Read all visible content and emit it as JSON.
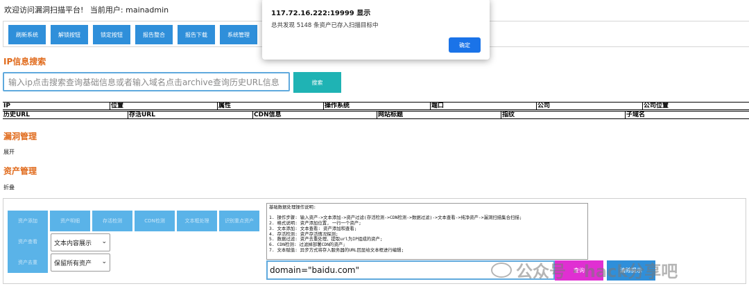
{
  "header": {
    "greeting": "欢迎访问漏洞扫描平台!",
    "current_user_label": "当前用户:",
    "username": "mainadmin"
  },
  "toolbar": {
    "buttons": [
      "刷新系统",
      "解锁按钮",
      "锁定按钮",
      "报告整合",
      "报告下载",
      "系统管理"
    ]
  },
  "ip_search": {
    "title": "IP信息搜索",
    "placeholder": "输入ip点击搜索查询基础信息或者输入域名点击archive查询历史URL信息",
    "button": "搜索"
  },
  "table": {
    "row1": [
      "IP",
      "位置",
      "属性",
      "操作系统",
      "端口",
      "公司",
      "公司位置"
    ],
    "row2": [
      "历史URL",
      "存活URL",
      "CDN信息",
      "网站标题",
      "指纹",
      "子域名"
    ]
  },
  "vuln_section": {
    "title": "漏洞管理",
    "toggle": "展开"
  },
  "asset_section": {
    "title": "资产管理",
    "toggle": "折叠"
  },
  "asset_panel": {
    "buttons": [
      "资产添加",
      "资产明细",
      "存活检测",
      "CDN检测",
      "文本框处理",
      "识别重点资产"
    ],
    "buttons_row2": [
      "资产查看",
      "资产去重"
    ],
    "display_select": "文本内容展示",
    "dedupe_select": "保留所有资产",
    "instructions": "基础数据处理操作说明:\n\n1. 操作步骤: 输入资产->文本添加->资产过滤(存活检测->CDN检测->数据过滤)->文本查看->纯净资产->漏洞扫描集合扫描;\n2. 格式说明: 资产添加位置, 一行一个资产;\n3. 文本添加: 文本查看: 资产添加和查看;\n4. 存活检测: 资产存活情况探测;\n5. 数据过滤: 资产去重处理、提取url为IP组成的资产;\n6. CDN检测: 过滤掉部署CDN的资产;\n7. 文本赋值: 异步方式将存入服务器的URL回显给文本框进行编辑;",
    "domain_value": "domain=\"baidu.com\"",
    "query_button": "查询",
    "clear_button": "清除提示"
  },
  "dialog": {
    "title": "117.72.16.222:19999 显示",
    "message": "总共发现 5148 条资产已存入扫描目标中",
    "ok_button": "确定"
  },
  "watermark": {
    "text": "公众号 · hack分享吧"
  }
}
